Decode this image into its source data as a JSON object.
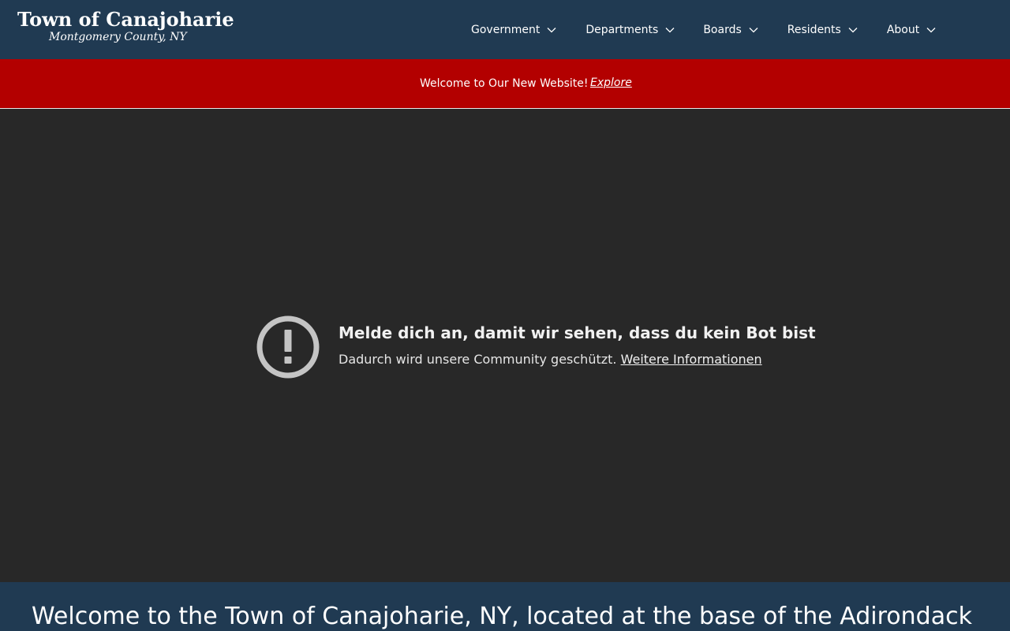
{
  "header": {
    "logo_title": "Town of Canajoharie",
    "logo_subtitle": "Montgomery County, NY",
    "nav": [
      {
        "label": "Government",
        "icon": "chevron-down-icon"
      },
      {
        "label": "Departments",
        "icon": "chevron-down-icon"
      },
      {
        "label": "Boards",
        "icon": "chevron-down-icon"
      },
      {
        "label": "Residents",
        "icon": "chevron-down-icon"
      },
      {
        "label": "About",
        "icon": "chevron-down-icon"
      }
    ]
  },
  "banner": {
    "text": "Welcome to Our New Website!",
    "link": "Explore"
  },
  "embed": {
    "icon": "exclamation-circle-icon",
    "heading": "Melde dich an, damit wir sehen, dass du kein Bot bist",
    "body": "Dadurch wird unsere Community geschützt.",
    "link": "Weitere Informationen"
  },
  "welcome": {
    "text": "Welcome to the Town of Canajoharie, NY, located at the base of the Adirondack"
  },
  "colors": {
    "header_bg": "#203a52",
    "banner_bg": "#b30000",
    "embed_bg": "#282828"
  }
}
